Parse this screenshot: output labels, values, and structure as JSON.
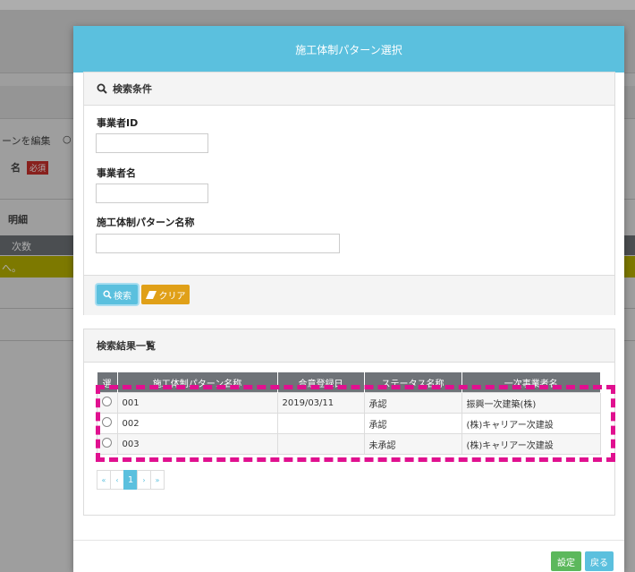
{
  "background": {
    "edit_pattern_text": "ーンを編集",
    "radio_mark": "○",
    "name_label": "名",
    "required_badge": "必須",
    "detail_label": "明細",
    "count_header": "次数",
    "row_text": "へ。"
  },
  "modal": {
    "title": "施工体制パターン選択",
    "search_panel": {
      "heading": "検索条件",
      "fields": [
        {
          "label": "事業者ID",
          "value": ""
        },
        {
          "label": "事業者名",
          "value": ""
        },
        {
          "label": "施工体制パターン名称",
          "value": ""
        }
      ],
      "search_button": "検索",
      "clear_button": "クリア"
    },
    "result_panel": {
      "heading": "検索結果一覧",
      "columns": [
        "選",
        "施工体制パターン名称",
        "合意登録日",
        "ステータス名称",
        "一次事業者名"
      ],
      "rows": [
        {
          "pattern": "001",
          "date": "2019/03/11",
          "status": "承認",
          "vendor": "振興一次建築(株)"
        },
        {
          "pattern": "002",
          "date": "",
          "status": "承認",
          "vendor": "(株)キャリアー次建設"
        },
        {
          "pattern": "003",
          "date": "",
          "status": "未承認",
          "vendor": "(株)キャリアー次建設"
        }
      ],
      "pager": {
        "first": "«",
        "prev": "‹",
        "current": "1",
        "next": "›",
        "last": "»"
      }
    },
    "footer": {
      "set_button": "設定",
      "back_button": "戻る"
    }
  },
  "colors": {
    "header": "#5bc0de",
    "highlight": "#e0108f",
    "table_header": "#6f7378"
  }
}
